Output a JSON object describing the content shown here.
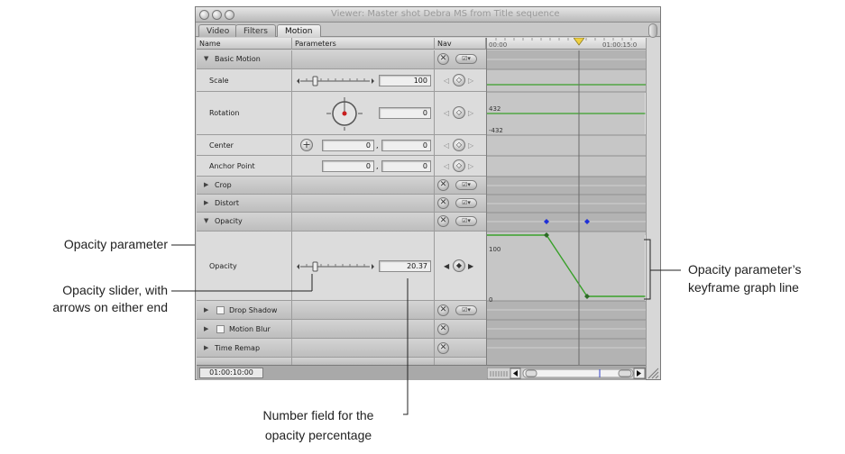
{
  "window": {
    "title": "Viewer: Master shot Debra MS from Title sequence",
    "tabs": [
      {
        "label": "Video",
        "active": false
      },
      {
        "label": "Filters",
        "active": false
      },
      {
        "label": "Motion",
        "active": true
      }
    ]
  },
  "columns": {
    "name": "Name",
    "parameters": "Parameters",
    "nav": "Nav"
  },
  "ruler": {
    "start": "00:00",
    "end": "01:00:15:0"
  },
  "rows": {
    "basic_motion": {
      "label": "Basic Motion",
      "expanded": true
    },
    "scale": {
      "label": "Scale",
      "value": "100"
    },
    "rotation": {
      "label": "Rotation",
      "value": "0",
      "graph_max": "432",
      "graph_min": "-432"
    },
    "center": {
      "label": "Center",
      "x": "0",
      "y": "0"
    },
    "anchor_point": {
      "label": "Anchor Point",
      "x": "0",
      "y": "0"
    },
    "crop": {
      "label": "Crop",
      "expanded": false
    },
    "distort": {
      "label": "Distort",
      "expanded": false
    },
    "opacity_group": {
      "label": "Opacity",
      "expanded": true
    },
    "opacity": {
      "label": "Opacity",
      "value": "20.37",
      "graph_max": "100",
      "graph_min": "0"
    },
    "drop_shadow": {
      "label": "Drop Shadow",
      "enabled": false
    },
    "motion_blur": {
      "label": "Motion Blur",
      "enabled": false
    },
    "time_remap": {
      "label": "Time Remap"
    }
  },
  "timecode": "01:00:10:00",
  "callouts": {
    "opacity_parameter": "Opacity parameter",
    "opacity_slider_line1": "Opacity slider, with",
    "opacity_slider_line2": "arrows on either end",
    "keyframe_line1": "Opacity parameter’s",
    "keyframe_line2": "keyframe graph line",
    "number_field_line1": "Number field for the",
    "number_field_line2": "opacity percentage"
  },
  "colors": {
    "graph_line": "#39a02a",
    "keyframe_marker": "#1f2fd8",
    "playhead": "#f0d040"
  }
}
